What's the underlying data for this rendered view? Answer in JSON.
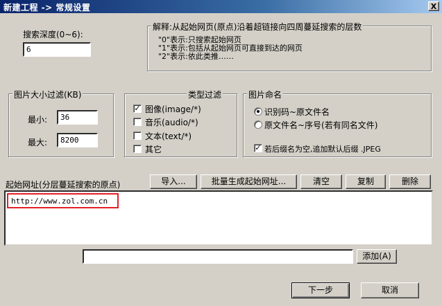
{
  "window": {
    "title": "新建工程 -> 常规设置",
    "close_glyph": "X"
  },
  "depth": {
    "label": "搜索深度(0~6):",
    "value": "6"
  },
  "explanation": {
    "legend": "解释:从起始网页(原点)沿着超链接向四周蔓延搜索的层数",
    "lines": [
      "\"0\"表示:只搜索起始网页",
      "\"1\"表示:包括从起始网页可直接到达的网页",
      "\"2\"表示:依此类推……"
    ]
  },
  "size_filter": {
    "legend": "图片大小过滤(KB)",
    "min_label": "最小:",
    "min_value": "36",
    "max_label": "最大:",
    "max_value": "8200"
  },
  "type_filter": {
    "legend": "类型过滤",
    "items": [
      {
        "label": "图像(image/*)",
        "checked": true
      },
      {
        "label": "音乐(audio/*)",
        "checked": false
      },
      {
        "label": "文本(text/*)",
        "checked": false
      },
      {
        "label": "其它",
        "checked": false
      }
    ]
  },
  "naming": {
    "legend": "图片命名",
    "options": [
      {
        "label": "识别码~原文件名",
        "selected": true
      },
      {
        "label": "原文件名~序号(若有同名文件)",
        "selected": false
      }
    ],
    "ext_checkbox": {
      "label": "若后缀名为空,追加默认后缀 .JPEG",
      "checked": true
    }
  },
  "start_urls": {
    "label": "起始网址(分层蔓延搜索的原点)",
    "buttons": {
      "import": "导入...",
      "batch": "批量生成起始网址...",
      "clear": "清空",
      "copy": "复制",
      "delete": "删除"
    },
    "items": [
      "http://www.zol.com.cn"
    ],
    "new_url_value": "",
    "add_button": "添加(A)"
  },
  "footer": {
    "next_button": "下一步",
    "cancel_button": "取消"
  }
}
